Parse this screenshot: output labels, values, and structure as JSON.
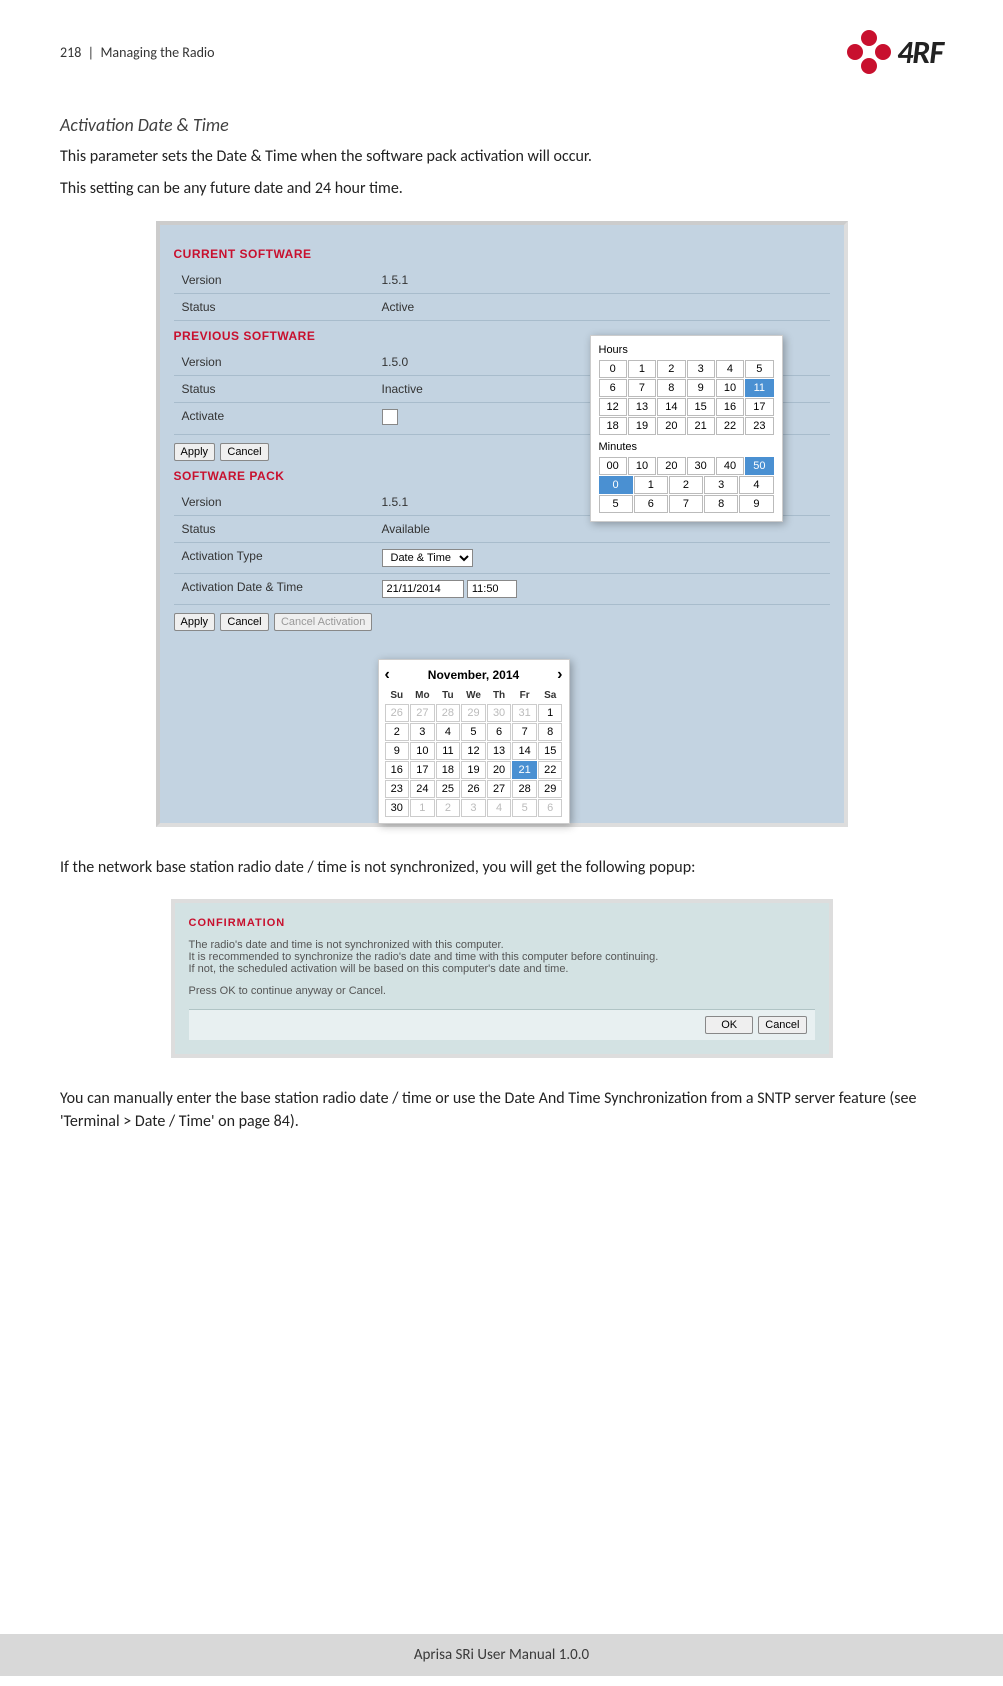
{
  "header": {
    "page_num": "218",
    "separator": "|",
    "section": "Managing the Radio",
    "logo_text": "4RF"
  },
  "content": {
    "heading": "Activation Date & Time",
    "p1": "This parameter sets the Date & Time when the software pack activation will occur.",
    "p2": "This setting can be any future date and 24 hour time.",
    "p3": "If the network base station radio date / time is not synchronized, you will get the following popup:",
    "p4": "You can manually enter the base station radio date / time or use the Date And Time Synchronization from a SNTP server feature (see 'Terminal > Date / Time' on page 84)."
  },
  "sw": {
    "current_heading": "CURRENT SOFTWARE",
    "prev_heading": "PREVIOUS SOFTWARE",
    "pack_heading": "SOFTWARE PACK",
    "labels": {
      "version": "Version",
      "status": "Status",
      "activate": "Activate",
      "act_type": "Activation Type",
      "act_dt": "Activation Date & Time"
    },
    "current": {
      "version": "1.5.1",
      "status": "Active"
    },
    "previous": {
      "version": "1.5.0",
      "status": "Inactive"
    },
    "pack": {
      "version": "1.5.1",
      "status": "Available",
      "act_type": "Date & Time",
      "date": "21/11/2014",
      "time": "11:50"
    },
    "buttons": {
      "apply": "Apply",
      "cancel": "Cancel",
      "cancel_act": "Cancel Activation"
    }
  },
  "calendar": {
    "title": "November, 2014",
    "weekdays": [
      "Su",
      "Mo",
      "Tu",
      "We",
      "Th",
      "Fr",
      "Sa"
    ],
    "lead_fade": [
      "26",
      "27",
      "28",
      "29",
      "30",
      "31"
    ],
    "days": [
      "1",
      "2",
      "3",
      "4",
      "5",
      "6",
      "7",
      "8",
      "9",
      "10",
      "11",
      "12",
      "13",
      "14",
      "15",
      "16",
      "17",
      "18",
      "19",
      "20",
      "21",
      "22",
      "23",
      "24",
      "25",
      "26",
      "27",
      "28",
      "29",
      "30"
    ],
    "trail_fade": [
      "1",
      "2",
      "3",
      "4",
      "5",
      "6"
    ],
    "selected": "21"
  },
  "time_picker": {
    "hours_label": "Hours",
    "minutes_label": "Minutes",
    "hours": [
      "0",
      "1",
      "2",
      "3",
      "4",
      "5",
      "6",
      "7",
      "8",
      "9",
      "10",
      "11",
      "12",
      "13",
      "14",
      "15",
      "16",
      "17",
      "18",
      "19",
      "20",
      "21",
      "22",
      "23"
    ],
    "hour_sel": "11",
    "min_tens": [
      "00",
      "10",
      "20",
      "30",
      "40",
      "50"
    ],
    "min_tens_sel": "50",
    "min_ones": [
      "0",
      "1",
      "2",
      "3",
      "4",
      "5",
      "6",
      "7",
      "8",
      "9"
    ],
    "min_ones_sel": "0"
  },
  "confirmation": {
    "title": "CONFIRMATION",
    "l1": "The radio's date and time is not synchronized with this computer.",
    "l2": "It is recommended to synchronize the radio's date and time with this computer before continuing.",
    "l3": "If not, the scheduled activation will be based on this computer's date and time.",
    "l4": "Press OK to continue anyway or Cancel.",
    "ok": "OK",
    "cancel": "Cancel"
  },
  "footer": "Aprisa SRi User Manual 1.0.0"
}
